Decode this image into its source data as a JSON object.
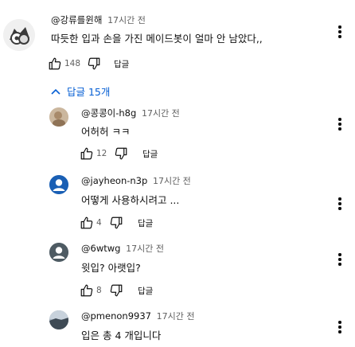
{
  "top_comment": {
    "author": "@강류를윈해",
    "time": "17시간 전",
    "text": "따듯한 입과 손을 가진 메이드봇이 얼마 안 남았다,,",
    "likes": "148",
    "reply_label": "답글",
    "avatar_icon": "robot-cat-avatar"
  },
  "replies_toggle": {
    "label": "답글 15개",
    "icon": "chevron-up-icon",
    "color": "#065fd4"
  },
  "replies": [
    {
      "author": "@콩콩이-h8g",
      "time": "17시간 전",
      "text": "어허허 ㅋㅋ",
      "likes": "12",
      "reply_label": "답글"
    },
    {
      "author": "@jayheon-n3p",
      "time": "17시간 전",
      "text": "어떻게 사용하시려고 ...",
      "likes": "4",
      "reply_label": "답글"
    },
    {
      "author": "@6wtwg",
      "time": "17시간 전",
      "text": "윗입? 아랫입?",
      "likes": "8",
      "reply_label": "답글"
    },
    {
      "author": "@pmenon9937",
      "time": "17시간 전",
      "text": "입은 총 4 개입니다",
      "likes": "",
      "reply_label": ""
    }
  ]
}
